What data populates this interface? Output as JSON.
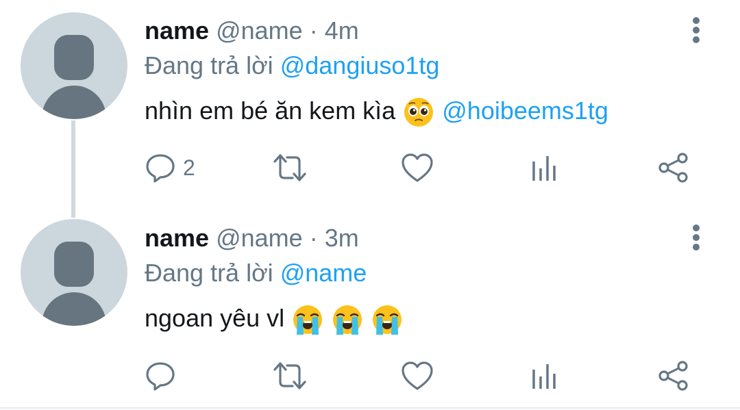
{
  "tweets": [
    {
      "name": "name",
      "handle": "@name",
      "separator": "·",
      "time": "4m",
      "reply_prefix": "Đang trả lời",
      "reply_to": "@dangiuso1tg",
      "text_main": "nhìn em bé ăn kem kìa",
      "emojis": [
        "pleading-face"
      ],
      "text_mention": "@hoibeems1tg",
      "reply_count": "2"
    },
    {
      "name": "name",
      "handle": "@name",
      "separator": "·",
      "time": "3m",
      "reply_prefix": "Đang trả lời",
      "reply_to": "@name",
      "text_main": "ngoan yêu vl",
      "emojis": [
        "loudly-crying-face",
        "loudly-crying-face",
        "loudly-crying-face"
      ],
      "text_mention": "",
      "reply_count": ""
    }
  ],
  "colors": {
    "link": "#1da1f2",
    "secondary_text": "#657786",
    "icon": "#657786",
    "avatar_bg": "#ccd6dd",
    "avatar_fg": "#66757f"
  }
}
